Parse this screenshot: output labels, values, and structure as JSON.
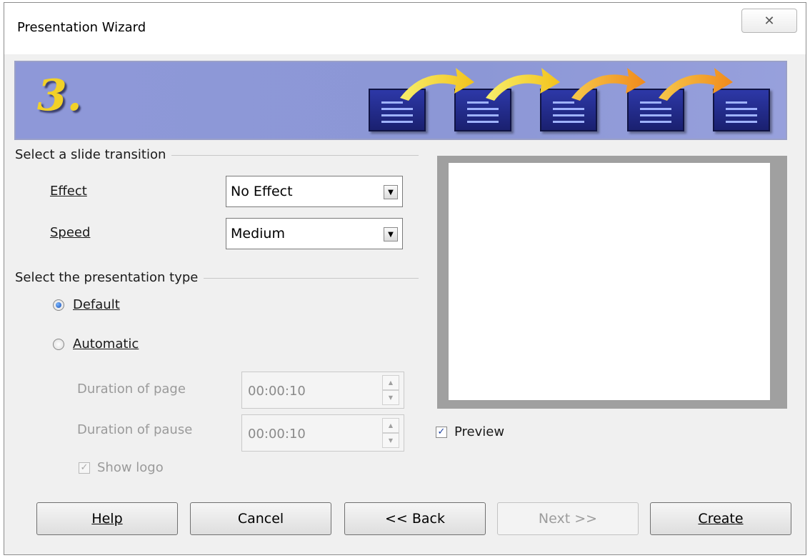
{
  "window": {
    "title": "Presentation Wizard",
    "close_symbol": "✕"
  },
  "banner": {
    "step_number": "3."
  },
  "transition": {
    "section_label": "Select a slide transition",
    "effect_label": "Effect",
    "effect_value": "No Effect",
    "speed_label": "Speed",
    "speed_value": "Medium"
  },
  "presentation_type": {
    "section_label": "Select the presentation type",
    "default_label": "Default",
    "automatic_label": "Automatic",
    "selected": "Default",
    "duration_page_label": "Duration of page",
    "duration_page_value": "00:00:10",
    "duration_pause_label": "Duration of pause",
    "duration_pause_value": "00:00:10",
    "show_logo_label": "Show logo",
    "show_logo_checked": true
  },
  "preview": {
    "checkbox_label": "Preview",
    "checked": true
  },
  "buttons": {
    "help": "Help",
    "cancel": "Cancel",
    "back": "<< Back",
    "next": "Next >>",
    "create": "Create"
  },
  "colors": {
    "banner": "#8e98d8",
    "step_number": "#f2d128",
    "slide_icon": "#2d38a8"
  }
}
